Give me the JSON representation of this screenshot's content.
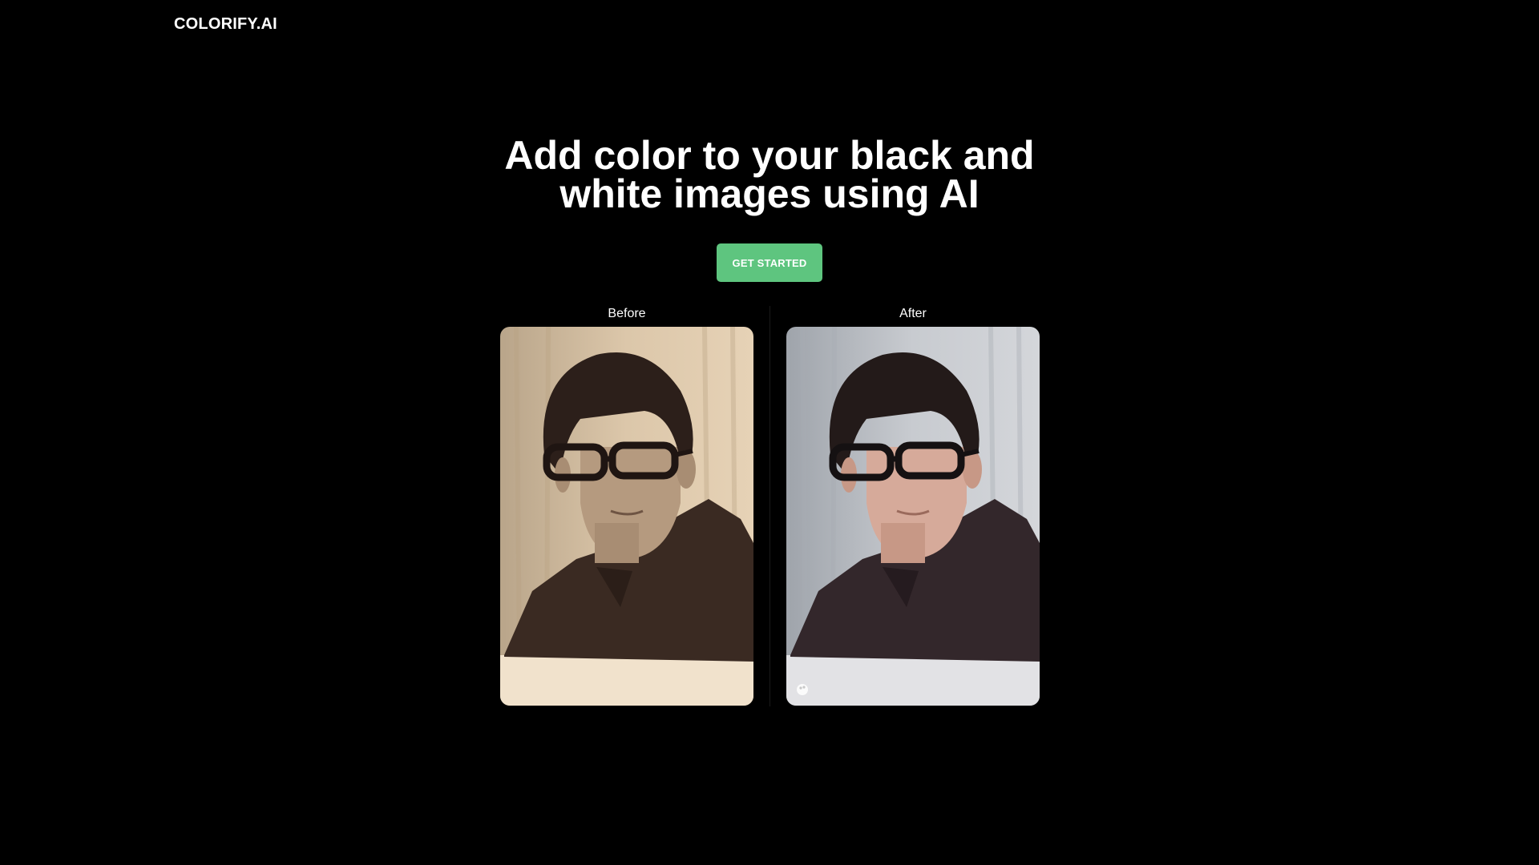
{
  "header": {
    "logo": "COLORIFY.AI"
  },
  "hero": {
    "title": "Add color to your black and white images using AI",
    "cta_label": "GET STARTED"
  },
  "comparison": {
    "before_label": "Before",
    "after_label": "After"
  }
}
